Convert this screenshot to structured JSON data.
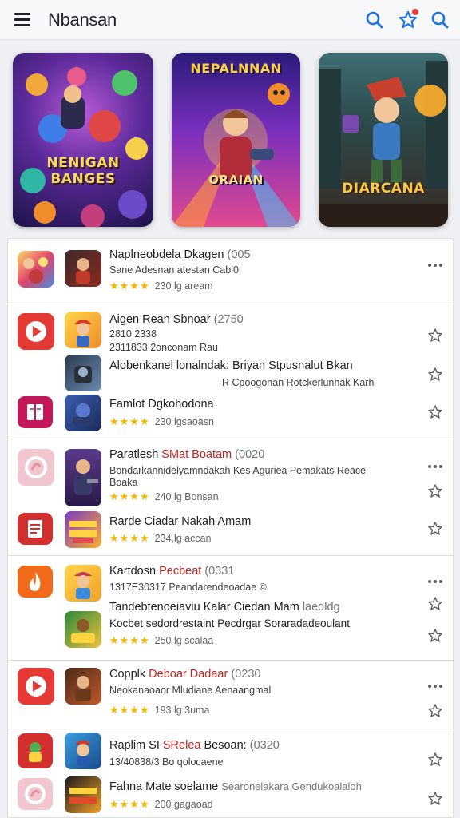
{
  "header": {
    "title": "Nbansan"
  },
  "banners": [
    {
      "caption": "NENIGAN BANGES"
    },
    {
      "top_caption": "NEPALNNAN",
      "caption": "ORAIAN"
    },
    {
      "caption": "DIARCANA"
    }
  ],
  "colors": {
    "accent": "#c5221f",
    "star": "#f5b400",
    "link": "#1a73e8"
  },
  "rows": [
    {
      "title": "Naplneobdela Dkagen",
      "title_suffix": "(005",
      "subtitle": "Sane Adesnan atestan Cabl0",
      "rating": "★★★★",
      "meta": "230 lg aream"
    },
    {
      "title": "Aigen Rean Sbnoar",
      "title_suffix": "(2750",
      "subtitle": "2810 2338",
      "meta2": "2311833 2onconam Rau"
    },
    {
      "title": "Alobenkanel lonalndak: Briyan Stpusnalut Bkan",
      "subtitle": "R Cpoogonan Rotckerlunhak Karh"
    },
    {
      "title": "Famlot Dgkohodona",
      "rating": "★★★★",
      "meta": "230 lgsaoasn"
    },
    {
      "title": "Paratlesh",
      "title_accent": "SMat Boatam",
      "title_suffix": "(0020",
      "subtitle": "Bondarkannidelyamndakah Kes Aguriea Pemakats Reace",
      "subtitle2": "Boaka",
      "rating": "★★★★",
      "meta": "240 lg Bonsan"
    },
    {
      "title": "Rarde Ciadar Nakah Amam",
      "rating": "★★★★",
      "meta": "234,lg accan"
    },
    {
      "title": "Kartdosn",
      "title_accent": "Pecbeat",
      "title_suffix": "(0331",
      "subtitle": "1317E30317 Peandarendeoadae ©"
    },
    {
      "title": "Tandebtenoeiaviu Kalar Ciedan Mam",
      "title_suffix": "laedldg",
      "subtitle": "Kocbet sedordrestaint Pecdrgar Soraradadeoulant",
      "rating": "★★★★",
      "meta": "250 lg scalaa"
    },
    {
      "title": "Copplk",
      "title_accent": "Deboar Dadaar",
      "title_suffix": "(0230",
      "subtitle": "Neokanaoaor Mludiane Aenaangmal",
      "rating": "★★★★",
      "meta": "193 lg 3uma"
    },
    {
      "title": "Raplim SI",
      "title_accent": "SRelea",
      "title_rest": "Besoan:",
      "title_suffix": "(0320",
      "subtitle": "13/40838/3 Bo qolocaene"
    },
    {
      "title": "Fahna Mate soelame",
      "title_gray": "Searonelakara Gendukoalaloh",
      "rating": "★★★★",
      "meta": "200 gagaoad"
    }
  ]
}
